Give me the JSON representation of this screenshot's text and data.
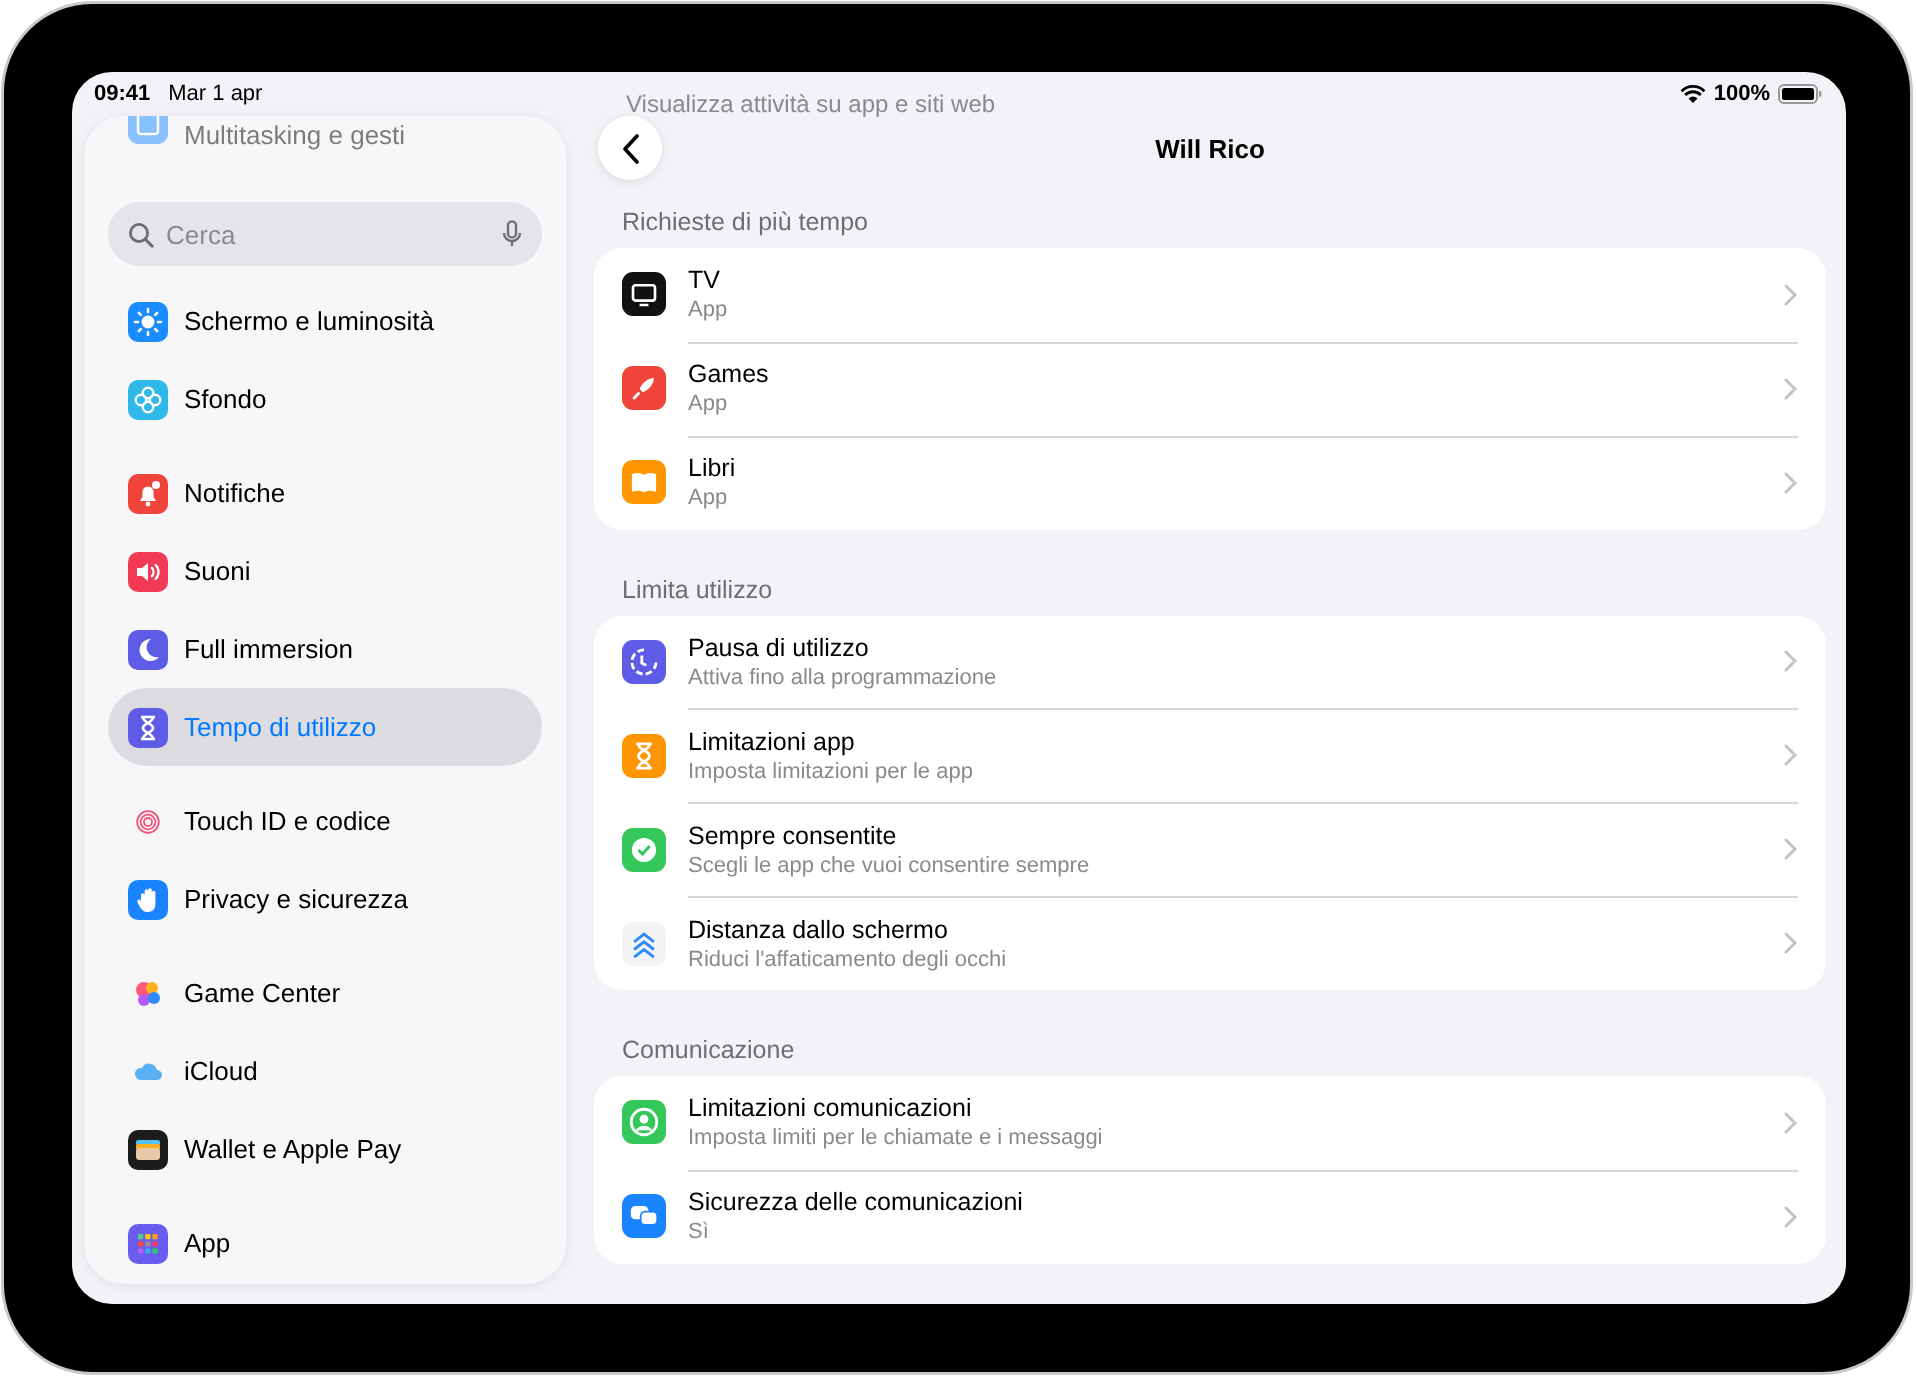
{
  "status_bar": {
    "time": "09:41",
    "date": "Mar 1 apr",
    "battery": "100%"
  },
  "sidebar": {
    "scrolled_item": "Multitasking e gesti",
    "search": {
      "placeholder": "Cerca"
    },
    "groups": [
      {
        "items": [
          {
            "label": "Schermo e luminosità",
            "selected": false
          },
          {
            "label": "Sfondo",
            "selected": false
          }
        ]
      },
      {
        "items": [
          {
            "label": "Notifiche",
            "selected": false
          },
          {
            "label": "Suoni",
            "selected": false
          },
          {
            "label": "Full immersion",
            "selected": false
          },
          {
            "label": "Tempo di utilizzo",
            "selected": true
          }
        ]
      },
      {
        "items": [
          {
            "label": "Touch ID e codice",
            "selected": false
          },
          {
            "label": "Privacy e sicurezza",
            "selected": false
          }
        ]
      },
      {
        "items": [
          {
            "label": "Game Center",
            "selected": false
          },
          {
            "label": "iCloud",
            "selected": false
          },
          {
            "label": "Wallet e Apple Pay",
            "selected": false
          }
        ]
      },
      {
        "items": [
          {
            "label": "App",
            "selected": false
          }
        ]
      }
    ]
  },
  "detail": {
    "scrolled_text": "Visualizza attività su app e siti web",
    "title": "Will Rico",
    "sections": [
      {
        "header": "Richieste di più tempo",
        "rows": [
          {
            "title": "TV",
            "subtitle": "App"
          },
          {
            "title": "Games",
            "subtitle": "App"
          },
          {
            "title": "Libri",
            "subtitle": "App"
          }
        ]
      },
      {
        "header": "Limita utilizzo",
        "rows": [
          {
            "title": "Pausa di utilizzo",
            "subtitle": "Attiva fino alla programmazione"
          },
          {
            "title": "Limitazioni app",
            "subtitle": "Imposta limitazioni per le app"
          },
          {
            "title": "Sempre consentite",
            "subtitle": "Scegli le app che vuoi consentire sempre"
          },
          {
            "title": "Distanza dallo schermo",
            "subtitle": "Riduci l'affaticamento degli occhi"
          }
        ]
      },
      {
        "header": "Comunicazione",
        "rows": [
          {
            "title": "Limitazioni comunicazioni",
            "subtitle": "Imposta limiti per le chiamate e i messaggi"
          },
          {
            "title": "Sicurezza delle comunicazioni",
            "subtitle": "Sì"
          }
        ]
      }
    ]
  }
}
